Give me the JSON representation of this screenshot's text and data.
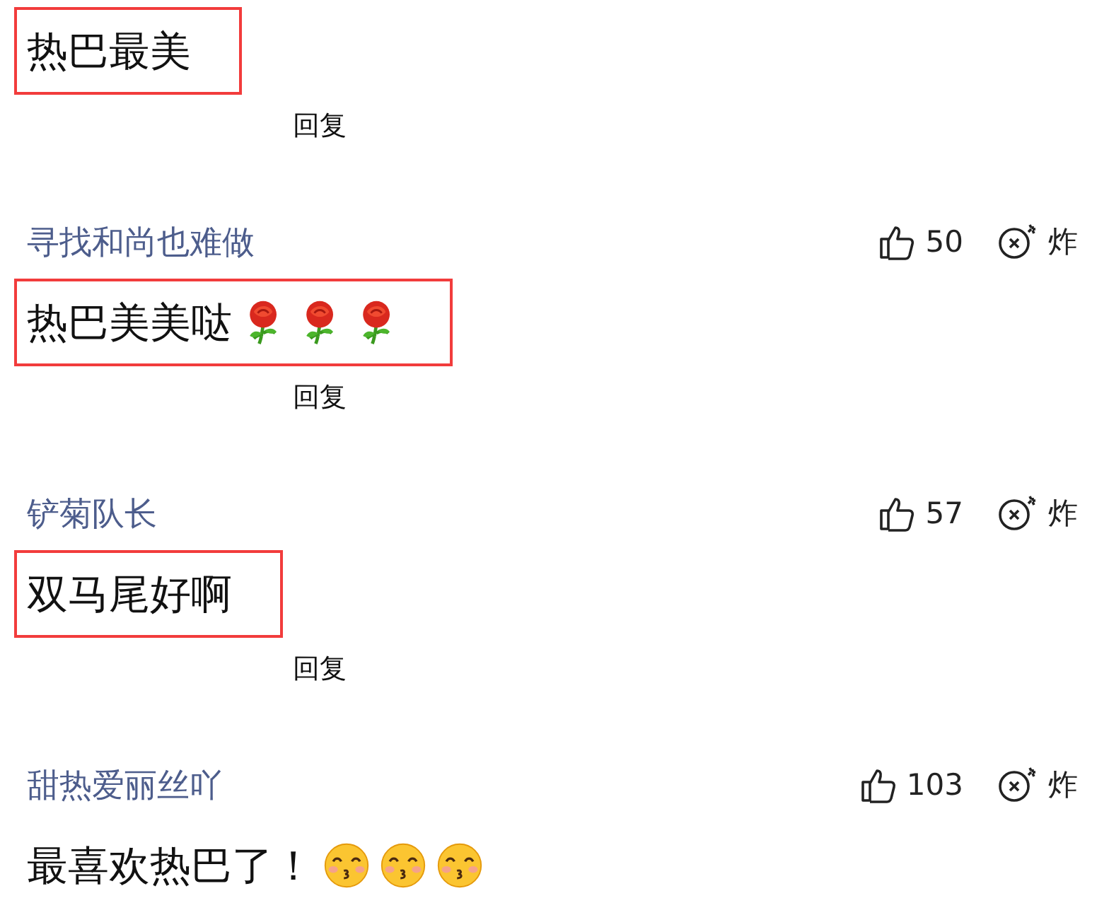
{
  "comments": [
    {
      "text": "热巴最美",
      "highlighted": true,
      "reply": "回复"
    },
    {
      "user": "寻找和尚也难做",
      "likes": "50",
      "bomb": "炸",
      "text": "热巴美美哒",
      "emojis": [
        {
          "kind": "rose"
        },
        {
          "kind": "rose"
        },
        {
          "kind": "rose"
        }
      ],
      "highlighted": true,
      "reply": "回复"
    },
    {
      "user": "铲菊队长",
      "likes": "57",
      "bomb": "炸",
      "text": "双马尾好啊",
      "highlighted": true,
      "reply": "回复"
    },
    {
      "user": "甜热爱丽丝吖",
      "likes": "103",
      "bomb": "炸",
      "text": "最喜欢热巴了！",
      "emojis": [
        {
          "kind": "kiss"
        },
        {
          "kind": "kiss"
        },
        {
          "kind": "kiss"
        }
      ],
      "highlighted": false
    }
  ]
}
